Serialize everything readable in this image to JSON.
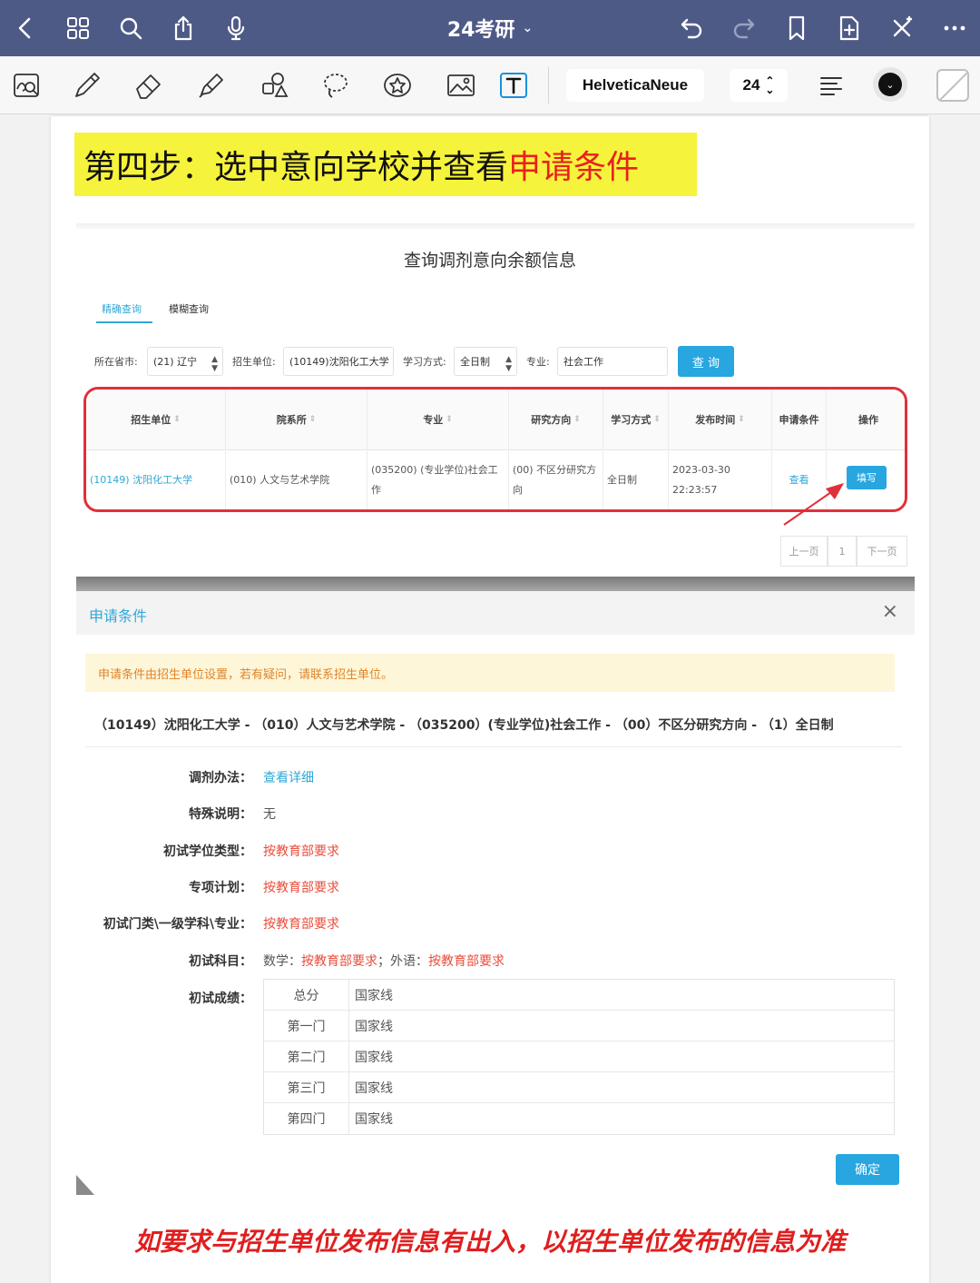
{
  "nav": {
    "doc_title": "24考研",
    "icons": [
      "back-chevron-icon",
      "grid-icon",
      "search-icon",
      "share-icon",
      "microphone-icon",
      "undo-icon",
      "redo-icon",
      "bookmark-icon",
      "add-page-icon",
      "close-x-icon",
      "more-icon"
    ]
  },
  "toolbar": {
    "icons": [
      "zoom-lasso-icon",
      "pen-icon",
      "eraser-icon",
      "highlighter-icon",
      "shapes-icon",
      "lasso-icon",
      "sticker-icon",
      "image-icon",
      "text-tool-icon"
    ],
    "font_name": "HelveticaNeue",
    "font_size": "24",
    "text_color": "#111111"
  },
  "page": {
    "step_title_prefix": "第四步：选中意向学校并查看",
    "step_title_highlight": "申请条件",
    "query_title": "查询调剂意向余额信息",
    "tabs": [
      "精确查询",
      "模糊查询"
    ],
    "filters": {
      "province_label": "所在省市:",
      "province_value": "(21) 辽宁",
      "unit_label": "招生单位:",
      "unit_value": "(10149)沈阳化工大学",
      "mode_label": "学习方式:",
      "mode_value": "全日制",
      "major_label": "专业:",
      "major_value": "社会工作",
      "query_button": "查 询"
    },
    "table": {
      "headers": [
        "招生单位",
        "院系所",
        "专业",
        "研究方向",
        "学习方式",
        "发布时间",
        "申请条件",
        "操作"
      ],
      "row": [
        "(10149) 沈阳化工大学",
        "(010) 人文与艺术学院",
        "(035200) (专业学位)社会工作",
        "(00) 不区分研究方向",
        "全日制",
        "2023-03-30 22:23:57",
        "查看",
        "填写"
      ]
    },
    "pager": {
      "prev": "上一页",
      "page": "1",
      "next": "下一页"
    },
    "modal": {
      "title": "申请条件",
      "notice": "申请条件由招生单位设置，若有疑问，请联系招生单位。",
      "program": "（10149）沈阳化工大学 - （010）人文与艺术学院 - （035200）(专业学位)社会工作 - （00）不区分研究方向 - （1）全日制",
      "fields": {
        "method_label": "调剂办法：",
        "method_value": "查看详细",
        "special_label": "特殊说明：",
        "special_value": "无",
        "degree_type_label": "初试学位类型：",
        "degree_type_value": "按教育部要求",
        "special_plan_label": "专项计划：",
        "special_plan_value": "按教育部要求",
        "category_label": "初试门类\\一级学科\\专业：",
        "category_value": "按教育部要求",
        "subjects_label": "初试科目：",
        "math_label": "数学：",
        "math_value": "按教育部要求",
        "foreign_label": "；外语：",
        "foreign_value": "按教育部要求",
        "scores_label": "初试成绩："
      },
      "scores": [
        {
          "name": "总分",
          "value": "国家线"
        },
        {
          "name": "第一门",
          "value": "国家线"
        },
        {
          "name": "第二门",
          "value": "国家线"
        },
        {
          "name": "第三门",
          "value": "国家线"
        },
        {
          "name": "第四门",
          "value": "国家线"
        }
      ],
      "confirm_button": "确定",
      "close_icon": "×"
    },
    "footer_note": "如要求与招生单位发布信息有出入，以招生单位发布的信息为准"
  },
  "colors": {
    "nav_bg": "#4e5a86",
    "highlight_yellow": "#f6f33c",
    "title_red": "#e8211e",
    "link_blue": "#2fa8d8",
    "button_blue": "#27a6e0",
    "outline_red": "#e0303a"
  }
}
